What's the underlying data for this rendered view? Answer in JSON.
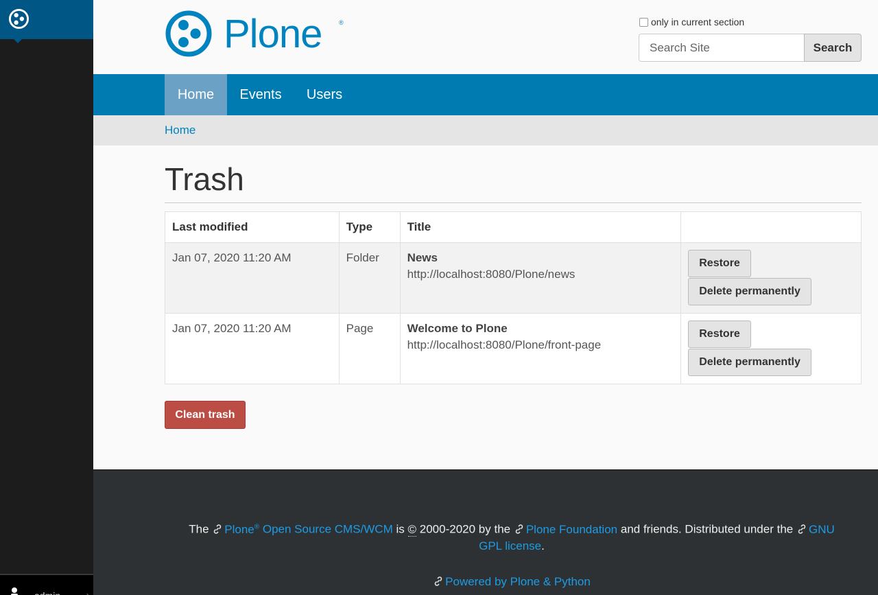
{
  "toolbar": {
    "user_name": "admin"
  },
  "header": {
    "logo_text": "Plone",
    "logo_reg": "®",
    "search_scope_label": "only in current section",
    "search_placeholder": "Search Site",
    "search_button": "Search"
  },
  "nav": {
    "items": [
      {
        "label": "Home"
      },
      {
        "label": "Events"
      },
      {
        "label": "Users"
      }
    ]
  },
  "breadcrumb": {
    "home": "Home"
  },
  "main": {
    "title": "Trash",
    "columns": [
      "Last modified",
      "Type",
      "Title",
      ""
    ],
    "rows": [
      {
        "modified": "Jan 07, 2020 11:20 AM",
        "type": "Folder",
        "title": "News",
        "url": "http://localhost:8080/Plone/news",
        "restore": "Restore",
        "delete": "Delete permanently"
      },
      {
        "modified": "Jan 07, 2020 11:20 AM",
        "type": "Page",
        "title": "Welcome to Plone",
        "url": "http://localhost:8080/Plone/front-page",
        "restore": "Restore",
        "delete": "Delete permanently"
      }
    ],
    "clean_trash": "Clean trash"
  },
  "footer": {
    "the": "The",
    "plone": "Plone",
    "reg": "®",
    "cms": "Open Source CMS/WCM",
    "is": "is",
    "copyright": "©",
    "years": "2000-2020 by the",
    "foundation": "Plone Foundation",
    "friends": "and friends. Distributed under the",
    "license": "GNU GPL license",
    "period": ".",
    "powered": "Powered by Plone & Python"
  },
  "colors": {
    "brand_blue": "#007bb1",
    "toolbar_blue": "#005785",
    "danger": "#bb4d44",
    "footer_bg": "#2e3133",
    "link": "#0083be"
  }
}
